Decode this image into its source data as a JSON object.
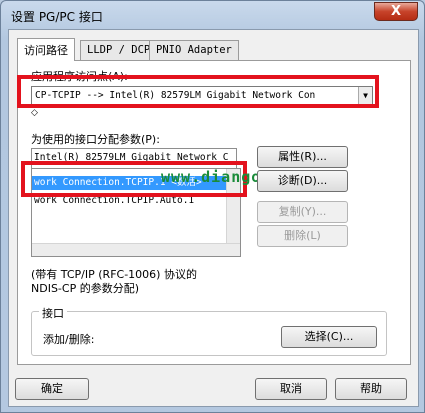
{
  "window": {
    "title": "设置 PG/PC 接口",
    "close_label": "X"
  },
  "tabs": [
    {
      "label": "访问路径"
    },
    {
      "label": "LLDP / DCP"
    },
    {
      "label": "PNIO Adapter"
    }
  ],
  "app_access_point": {
    "label": "应用程序访问点(A):",
    "value": "CP-TCPIP        --> Intel(R) 82579LM Gigabit Network Con",
    "below_marker": "◇"
  },
  "interface_params": {
    "label": "为使用的接口分配参数(P):",
    "header_row": "Intel(R) 82579LM Gigabit Network C",
    "items": [
      "work Connection.TCPIP.1  <数活>",
      "work Connection.TCPIP.Auto.1"
    ],
    "selected_index": 0
  },
  "buttons": {
    "properties": "属性(R)...",
    "diagnostics": "诊断(D)...",
    "copy": "复制(Y)...",
    "delete": "删除(L)",
    "select": "选择(C)...",
    "ok": "确定",
    "cancel": "取消",
    "help": "帮助"
  },
  "description": {
    "line1": "(带有 TCP/IP (RFC-1006) 协议的",
    "line2": "NDIS-CP 的参数分配)"
  },
  "interface_group": {
    "title": "接口",
    "add_remove_label": "添加/删除:"
  },
  "watermark": "www.diangon.com",
  "colors": {
    "highlight_box": "#e3121d",
    "selection": "#3399ff",
    "watermark": "#1a8c3a"
  }
}
